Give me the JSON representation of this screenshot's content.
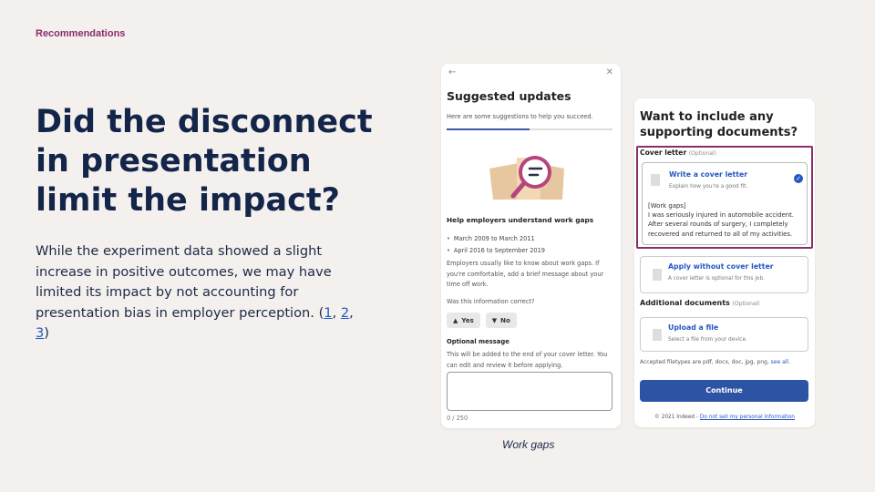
{
  "section_label": "Recommendations",
  "headline": "Did the disconnect in presentation limit the impact?",
  "body": {
    "text": "While the experiment data showed a slight increase in positive outcomes, we may have limited its impact by not accounting for presentation bias in employer perception. (",
    "refs": [
      "1",
      "2",
      "3"
    ],
    "sep": ", ",
    "close": ")"
  },
  "card1": {
    "back_icon": "arrow-left-icon",
    "close_icon": "close-icon",
    "title": "Suggested updates",
    "subtitle": "Here are some suggestions to help you succeed.",
    "progress": 0.5,
    "heading": "Help employers understand work gaps",
    "bullets": [
      "March 2009 to March 2011",
      "April 2016 to September 2019"
    ],
    "paragraph": "Employers usually like to know about work gaps. If you're comfortable, add a brief message about your time off work.",
    "question": "Was this information correct?",
    "yes_label": "Yes",
    "no_label": "No",
    "optional_title": "Optional message",
    "optional_sub": "This will be added to the end of your cover letter. You can edit and review it before applying.",
    "char_count": "0 / 250"
  },
  "caption": "Work gaps",
  "card2": {
    "title": "Want to include any supporting documents?",
    "cover_letter_label": "Cover letter",
    "optional_tag": "(Optional)",
    "write_link": "Write a cover letter",
    "write_sub": "Explain how you're a good fit.",
    "gap_text": "[Work gaps]\nI was seriously injured in automobile accident. After several rounds of surgery, I completely recovered and returned to all of my activities.",
    "apply_link": "Apply without cover letter",
    "apply_sub": "A cover letter is optional for this job.",
    "additional_label": "Additional documents",
    "upload_link": "Upload a file",
    "upload_sub": "Select a file from your device.",
    "types_text": "Accepted filetypes are pdf, docx, doc, jpg, png, ",
    "see_all": "see all.",
    "continue_label": "Continue",
    "footer_text": "© 2021 Indeed - ",
    "footer_link": "Do not sell my personal information"
  },
  "colors": {
    "accent": "#8a2d6a",
    "headline": "#14254a",
    "primary": "#2d54a4"
  }
}
